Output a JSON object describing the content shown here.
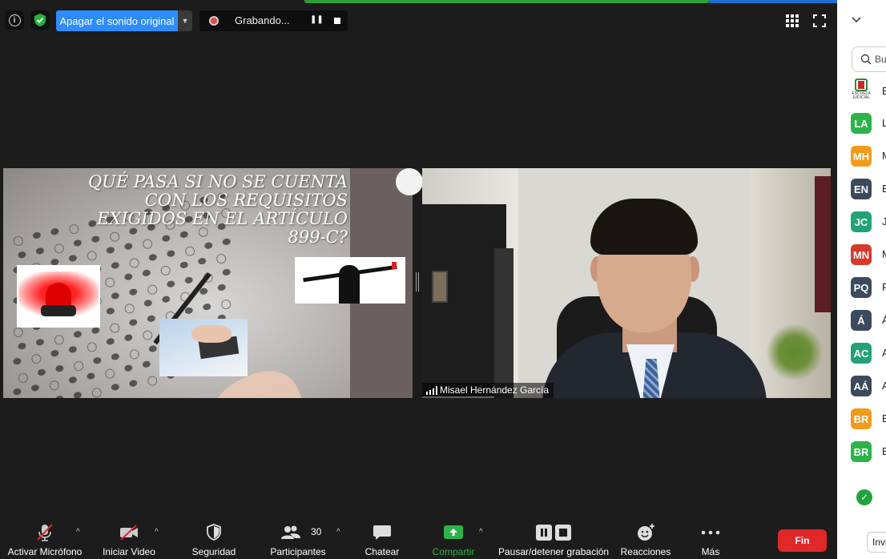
{
  "topbar": {
    "mute_original_label": "Apagar el sonido original",
    "recording_label": "Grabando..."
  },
  "slide": {
    "title_lines": [
      "QUÉ PASA SI NO SE CUENTA",
      "CON LOS REQUISITOS",
      "EXIGIDOS EN EL ARTÍCULO",
      "899-C?"
    ]
  },
  "camera": {
    "participant_name": "Misael Hernández García"
  },
  "panel": {
    "search_placeholder": "Bu",
    "participants": [
      {
        "initials": "LA",
        "color": "#2db34a",
        "name_start": "L"
      },
      {
        "initials": "MH",
        "color": "#f29a1a",
        "name_start": "M"
      },
      {
        "initials": "EN",
        "color": "#3b4a5c",
        "name_start": "E"
      },
      {
        "initials": "JC",
        "color": "#23a27a",
        "name_start": "J"
      },
      {
        "initials": "MN",
        "color": "#d63a2a",
        "name_start": "M"
      },
      {
        "initials": "PQ",
        "color": "#3b4a5c",
        "name_start": "P"
      },
      {
        "initials": "Á",
        "color": "#3b4a5c",
        "name_start": "Á"
      },
      {
        "initials": "AC",
        "color": "#23a27a",
        "name_start": "A"
      },
      {
        "initials": "AÁ",
        "color": "#3b4a5c",
        "name_start": "A"
      },
      {
        "initials": "BR",
        "color": "#f29a1a",
        "name_start": "B"
      },
      {
        "initials": "BR",
        "color": "#2db34a",
        "name_start": "B"
      }
    ],
    "school_logo_text": "ESCUELA JUDICIAL",
    "school_name_start": "E",
    "invite_label": "Invi"
  },
  "toolbar": {
    "mic_label": "Activar Micrófono",
    "video_label": "Iniciar Video",
    "security_label": "Seguridad",
    "participants_label": "Participantes",
    "participants_count": "30",
    "chat_label": "Chatear",
    "share_label": "Compartir",
    "record_label": "Pausar/detener grabación",
    "reactions_label": "Reacciones",
    "more_label": "Más",
    "end_label": "Fin"
  },
  "colors": {
    "share_green": "#2eb34a",
    "end_red": "#e02828",
    "accent_blue": "#2d8cff"
  }
}
